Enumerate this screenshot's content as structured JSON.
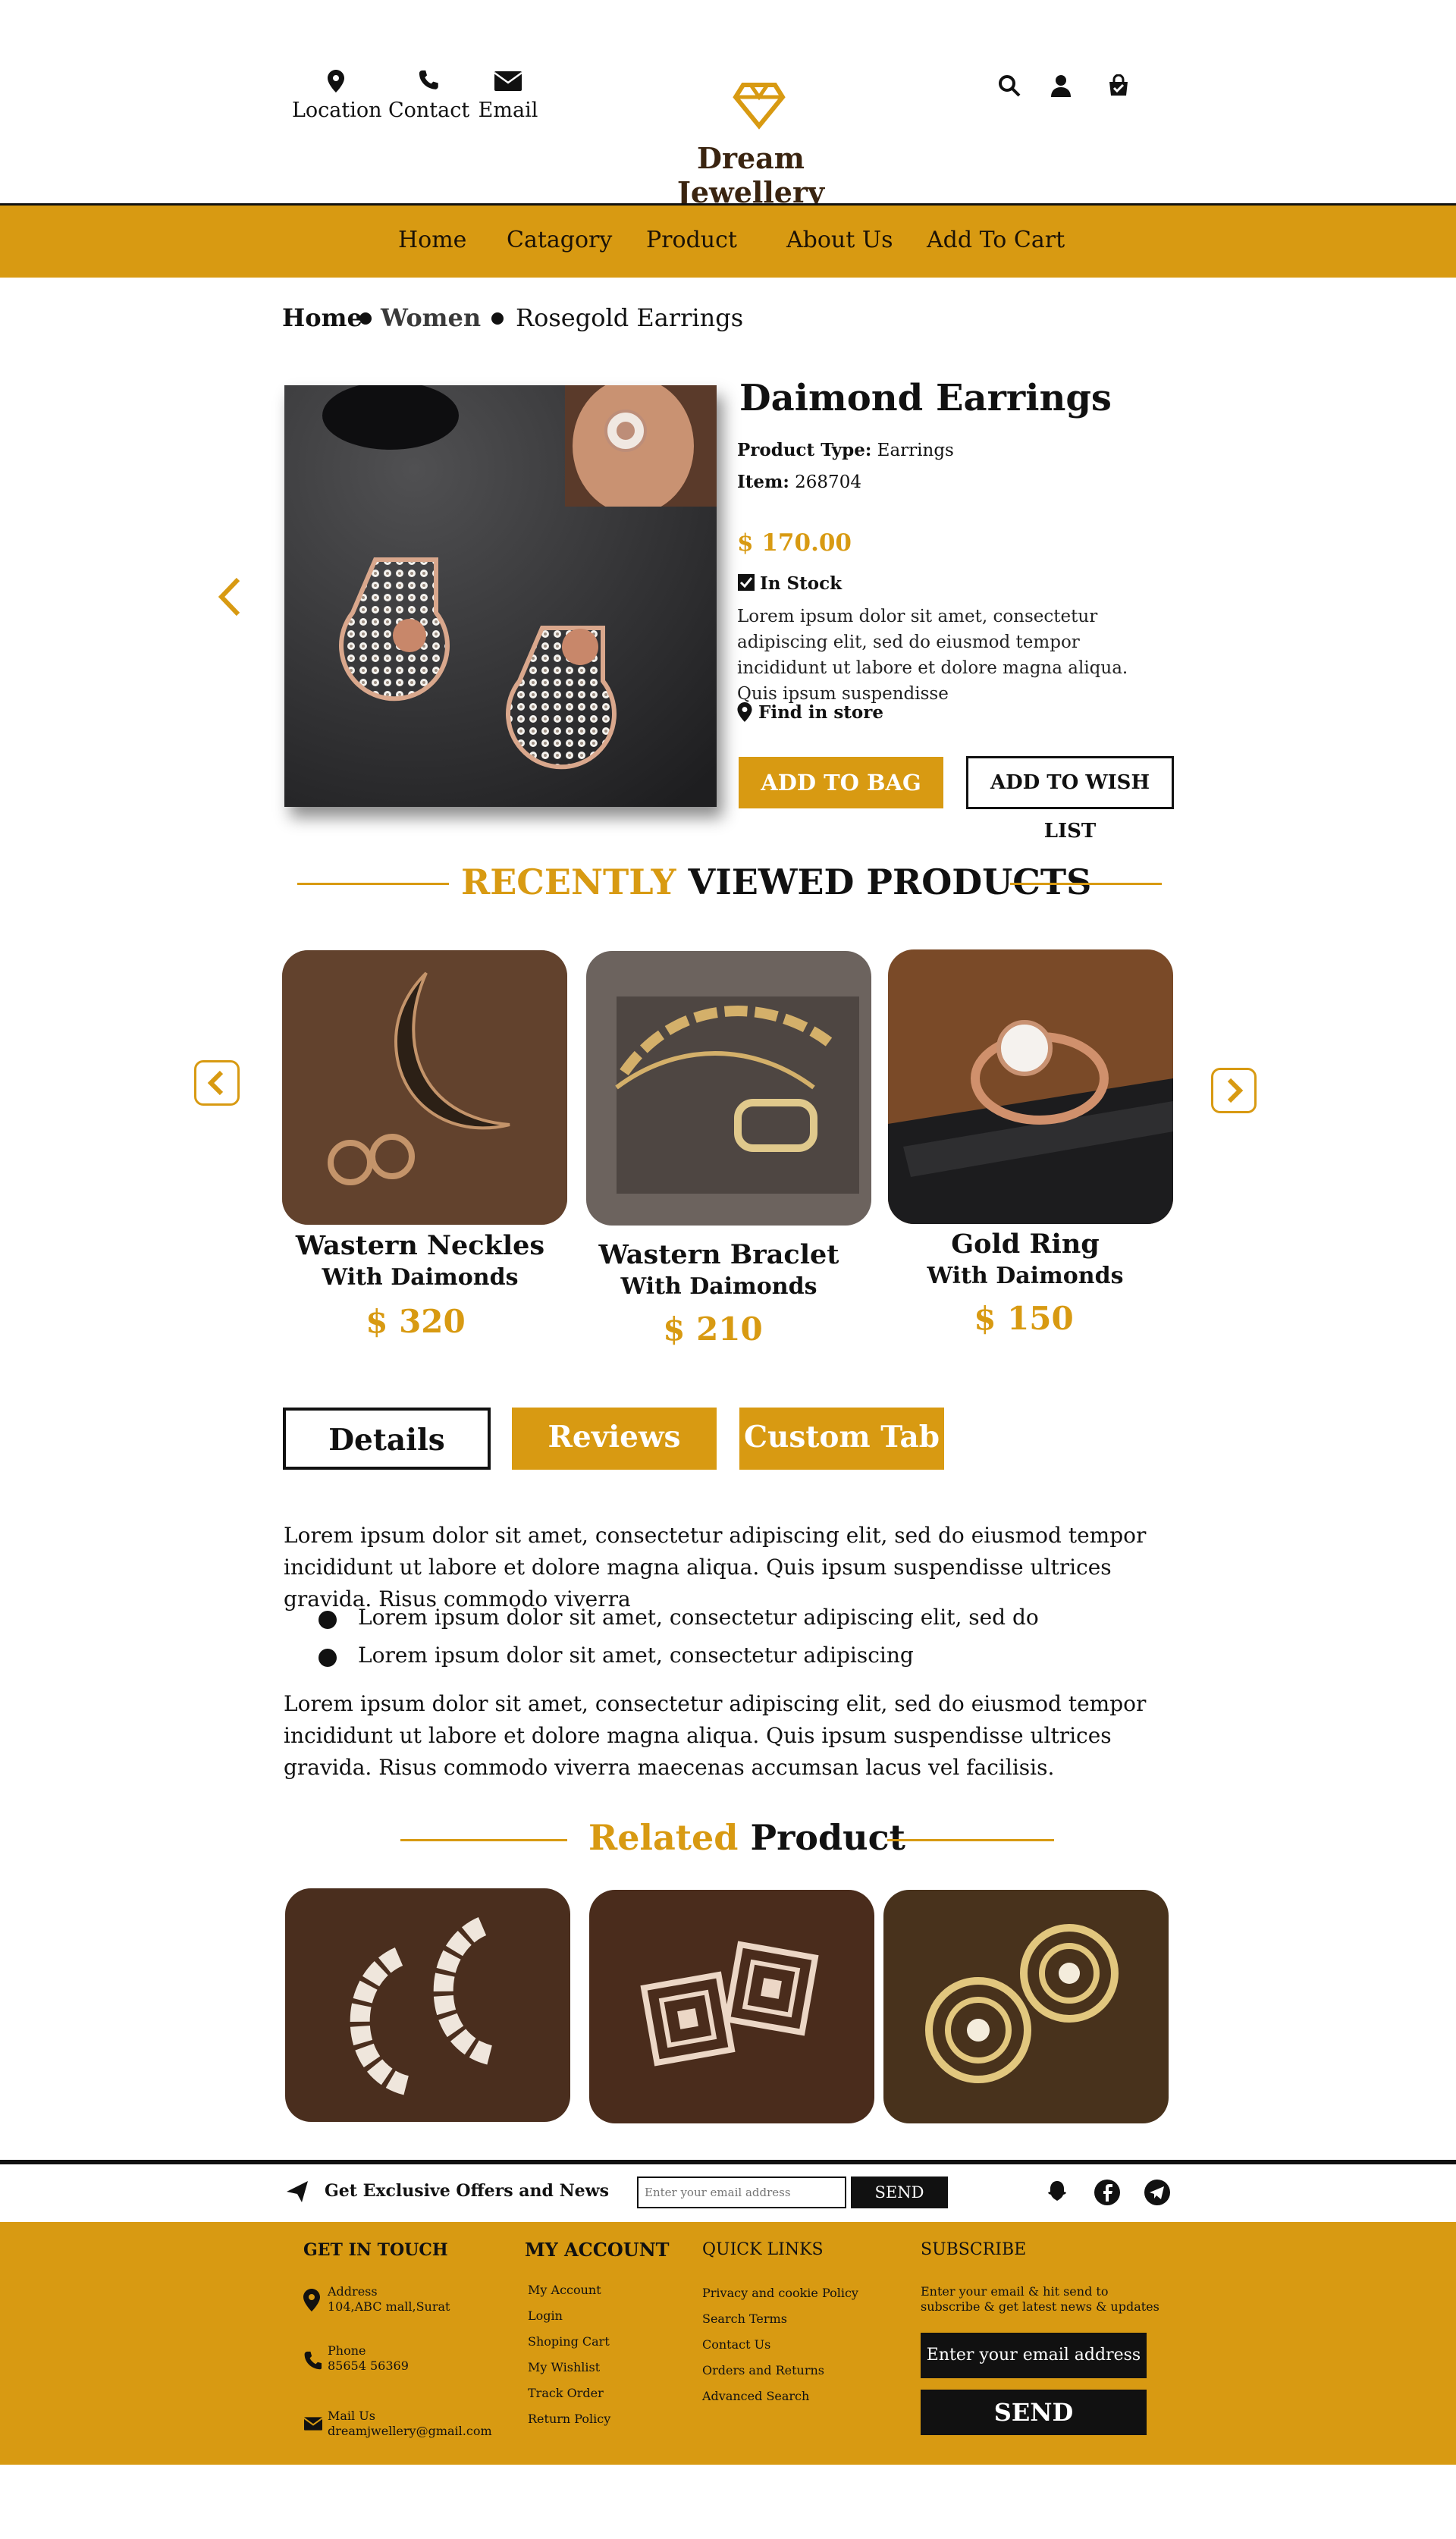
{
  "header": {
    "location_label": "Location",
    "contact_label": "Contact",
    "email_label": "Email",
    "brand": "Dream Jewellery"
  },
  "nav": {
    "items": [
      "Home",
      "Catagory",
      "Product",
      "About Us",
      "Add To Cart"
    ]
  },
  "breadcrumb": {
    "home": "Home",
    "women": "Women",
    "current": "Rosegold Earrings"
  },
  "product": {
    "title": "Daimond Earrings",
    "type_label": "Product Type:",
    "type_value": "Earrings",
    "item_label": "Item:",
    "item_value": "268704",
    "price": "$ 170.00",
    "stock": "In Stock",
    "description": "Lorem ipsum dolor sit amet, consectetur adipiscing elit, sed do eiusmod tempor incididunt ut labore et dolore magna aliqua. Quis ipsum suspendisse",
    "find_store": "Find in store",
    "add_to_bag": "ADD TO BAG",
    "add_to_wishlist": "ADD TO WISH LIST"
  },
  "recent": {
    "title_accent": "RECENTLY",
    "title_rest": "VIEWED PRODUCTS",
    "cards": [
      {
        "name": "Wastern Neckles",
        "sub": "With Daimonds",
        "price": "$ 320"
      },
      {
        "name": "Wastern Braclet",
        "sub": "With Daimonds",
        "price": "$ 210"
      },
      {
        "name": "Gold Ring",
        "sub": "With Daimonds",
        "price": "$ 150"
      }
    ]
  },
  "tabs": {
    "details": "Details",
    "reviews": "Reviews",
    "custom": "Custom Tab"
  },
  "details": {
    "para1": "Lorem ipsum dolor sit amet, consectetur adipiscing elit, sed do eiusmod tempor incididunt ut labore et dolore magna aliqua. Quis ipsum suspendisse ultrices gravida. Risus commodo viverra",
    "bullet1": "Lorem ipsum dolor sit amet, consectetur adipiscing elit, sed do",
    "bullet2": "Lorem ipsum dolor sit amet, consectetur adipiscing",
    "para2": "Lorem ipsum dolor sit amet, consectetur adipiscing elit, sed do eiusmod tempor incididunt ut labore et dolore magna aliqua. Quis ipsum suspendisse ultrices gravida. Risus commodo viverra maecenas accumsan lacus vel facilisis."
  },
  "related": {
    "title_accent": "Related",
    "title_rest": "Product"
  },
  "newsletter": {
    "label": "Get Exclusive Offers and News",
    "placeholder": "Enter your email address",
    "send": "SEND"
  },
  "footer": {
    "get_in_touch": "GET IN TOUCH",
    "address_label": "Address",
    "address_value": "104,ABC mall,Surat",
    "phone_label": "Phone",
    "phone_value": "85654 56369",
    "mail_label": "Mail Us",
    "mail_value": "dreamjwellery@gmail.com",
    "my_account": "MY ACCOUNT",
    "account_links": [
      "My Account",
      "Login",
      "Shoping Cart",
      "My Wishlist",
      "Track Order",
      "Return Policy"
    ],
    "quick_links": "QUICK LINKS",
    "quick_items": [
      "Privacy and cookie Policy",
      "Search Terms",
      "Contact Us",
      "Orders and Returns",
      "Advanced Search"
    ],
    "subscribe": "SUBSCRIBE",
    "subscribe_text": "Enter your email & hit send to subscribe & get latest news & updates",
    "subscribe_placeholder": "Enter your email address",
    "subscribe_send": "SEND"
  },
  "colors": {
    "accent": "#d89a12",
    "dark": "#111111"
  }
}
